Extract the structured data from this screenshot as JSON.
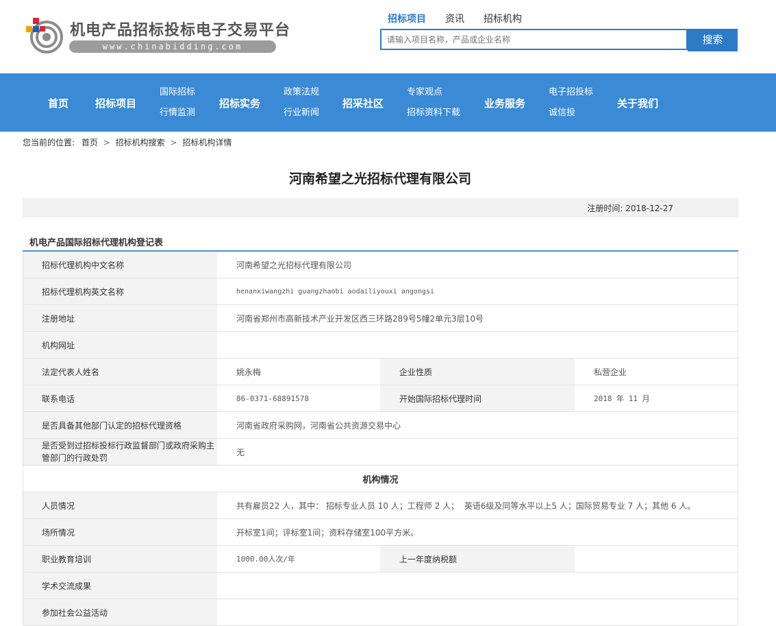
{
  "header": {
    "logo_title": "机电产品招标投标电子交易平台",
    "logo_sub": "www.chinabidding.com",
    "search_tabs": [
      "招标项目",
      "资讯",
      "招标机构"
    ],
    "search_placeholder": "请输入项目名称，产品或企业名称",
    "search_button": "搜索"
  },
  "nav": {
    "home": "首页",
    "projects": "招标项目",
    "intl_bid": "国际招标",
    "monitor": "行情监测",
    "practice": "招标实务",
    "policy": "政策法规",
    "industry_news": "行业新闻",
    "community": "招采社区",
    "expert": "专家观点",
    "downloads": "招标资料下载",
    "services": "业务服务",
    "ebid": "电子招投标",
    "credit": "诚信投",
    "about": "关于我们"
  },
  "breadcrumb": {
    "prefix": "您当前的位置:",
    "items": [
      "首页",
      "招标机构搜索",
      "招标机构详情"
    ]
  },
  "company": {
    "title": "河南希望之光招标代理有限公司",
    "reg_label": "注册时间:",
    "reg_date": "2018-12-27"
  },
  "form": {
    "section_title": "机电产品国际招标代理机构登记表",
    "rows": {
      "cn_name_label": "招标代理机构中文名称",
      "cn_name": "河南希望之光招标代理有限公司",
      "en_name_label": "招标代理机构英文名称",
      "en_name": "henanxiwangzhi guangzhaobi aodailiyouxi angongsi",
      "address_label": "注册地址",
      "address": "河南省郑州市高新技术产业开发区西三环路289号5幢2单元3层10号",
      "website_label": "机构网址",
      "website": "",
      "legal_rep_label": "法定代表人姓名",
      "legal_rep": "姚永梅",
      "nature_label": "企业性质",
      "nature": "私营企业",
      "phone_label": "联系电话",
      "phone": "86-0371-68891578",
      "start_label": "开始国际招标代理时间",
      "start": "2018 年 11 月",
      "qual_label": "是否具备其他部门认定的招标代理资格",
      "qual": "河南省政府采购网，河南省公共资源交易中心",
      "penalty_label": "是否受到过招标投标行政监督部门或政府采购主管部门的行政处罚",
      "penalty": "无",
      "org_section": "机构情况",
      "staff_label": "人员情况",
      "staff": "共有雇员22 人，其中： 招标专业人员 10 人；工程师 2 人；  英语6级及同等水平以上5 人；国际贸易专业 7 人；其他 6 人。",
      "venue_label": "场所情况",
      "venue": "开标室1间；评标室1间；资料存储室100平方米。",
      "training_label": "职业教育培训",
      "training": "1000.00人次/年",
      "tax_label": "上一年度纳税额",
      "tax": "",
      "academic_label": "学术交流成果",
      "academic": "",
      "welfare_label": "参加社会公益活动",
      "welfare": ""
    }
  },
  "colors": {
    "brand_blue": "#3a8ad6",
    "search_blue": "#2d7bc6",
    "label_bg": "#f3f3f3"
  }
}
